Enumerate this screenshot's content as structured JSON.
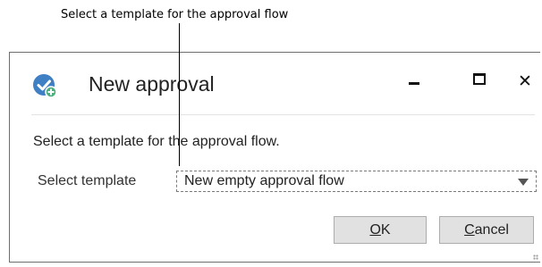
{
  "callout": {
    "text": "Select a template for the approval flow"
  },
  "dialog": {
    "title": "New approval",
    "icon": "approval-check-icon",
    "close_glyph": "✕",
    "instruction": "Select a template for the approval flow.",
    "template_field": {
      "label": "Select template",
      "value": "New empty approval flow"
    },
    "buttons": {
      "ok_accel": "O",
      "ok_rest": "K",
      "cancel_accel": "C",
      "cancel_rest": "ancel"
    }
  },
  "colors": {
    "icon_blue": "#3f7fc4",
    "icon_green": "#4caf7d"
  }
}
